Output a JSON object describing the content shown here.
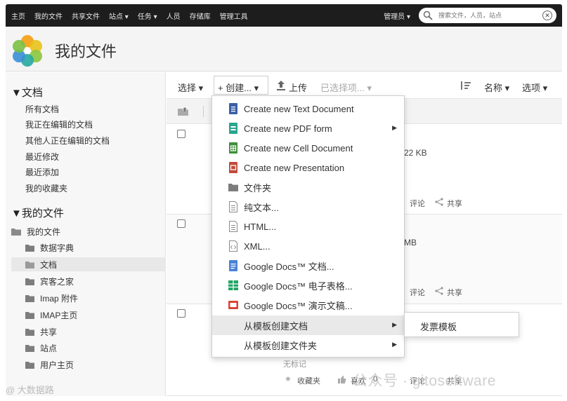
{
  "topbar": {
    "nav": [
      "主页",
      "我的文件",
      "共享文件",
      "站点 ▾",
      "任务 ▾",
      "人员",
      "存储库",
      "管理工具"
    ],
    "admin": "管理员 ▾",
    "search_placeholder": "搜索文件，人员，站点"
  },
  "header": {
    "title": "我的文件"
  },
  "sidebar": {
    "documents_heading": "▼文档",
    "document_links": [
      "所有文档",
      "我正在编辑的文档",
      "其他人正在编辑的文档",
      "最近修改",
      "最近添加",
      "我的收藏夹"
    ],
    "myfiles_heading": "▼我的文件",
    "tree_root": "我的文件",
    "tree_children": [
      "数据字典",
      "文档",
      "宾客之家",
      "Imap 附件",
      "IMAP主页",
      "共享",
      "站点",
      "用户主页"
    ],
    "selected_index": 1
  },
  "toolbar": {
    "select": "选择 ▾",
    "create": "+ 创建... ▾",
    "upload": "上传",
    "selected_items": "已选择项... ▾",
    "sort_name": "名称 ▾",
    "options": "选项 ▾"
  },
  "rows": [
    {
      "size": "22 KB",
      "comment": "评论",
      "share": "共享"
    },
    {
      "size": "MB",
      "comment": "评论",
      "share": "共享"
    },
    {
      "tag": "无标记",
      "favorite": "收藏夹",
      "like": "喜欢",
      "like_count": "0",
      "comment": "评论",
      "share": "共享"
    }
  ],
  "create_menu": {
    "items": [
      {
        "label": "Create new Text Document",
        "icon": "text-doc-icon",
        "color": "#3a5ea8",
        "submenu": false
      },
      {
        "label": "Create new PDF form",
        "icon": "pdf-form-icon",
        "color": "#2aa58f",
        "submenu": true
      },
      {
        "label": "Create new Cell Document",
        "icon": "cell-doc-icon",
        "color": "#3e8f3a",
        "submenu": false
      },
      {
        "label": "Create new Presentation",
        "icon": "presentation-icon",
        "color": "#c24a3a",
        "submenu": false
      },
      {
        "label": "文件夹",
        "icon": "folder-icon",
        "color": "#7d7d7d",
        "submenu": false
      },
      {
        "label": "纯文本...",
        "icon": "plain-text-icon",
        "color": "#8a8a8a",
        "submenu": false
      },
      {
        "label": "HTML...",
        "icon": "html-icon",
        "color": "#8a8a8a",
        "submenu": false
      },
      {
        "label": "XML...",
        "icon": "xml-icon",
        "color": "#8a8a8a",
        "submenu": false
      },
      {
        "label": "Google Docs™ 文档...",
        "icon": "google-docs-icon",
        "color": "#4b82d9",
        "submenu": false
      },
      {
        "label": "Google Docs™ 电子表格...",
        "icon": "google-sheets-icon",
        "color": "#21a464",
        "submenu": false
      },
      {
        "label": "Google Docs™ 演示文稿...",
        "icon": "google-slides-icon",
        "color": "#d94535",
        "submenu": false
      },
      {
        "label": "从模板创建文档",
        "icon": "",
        "color": "",
        "submenu": true
      },
      {
        "label": "从模板创建文件夹",
        "icon": "",
        "color": "",
        "submenu": true
      }
    ],
    "highlighted_index": 11
  },
  "template_submenu": {
    "items": [
      "发票模板"
    ]
  },
  "watermarks": {
    "left": "@ 大数据路",
    "right": "公众号 · gitosoftware"
  },
  "colors": {
    "topbar": "#1d1d1d",
    "menu_highlight": "#e9e9e9"
  }
}
